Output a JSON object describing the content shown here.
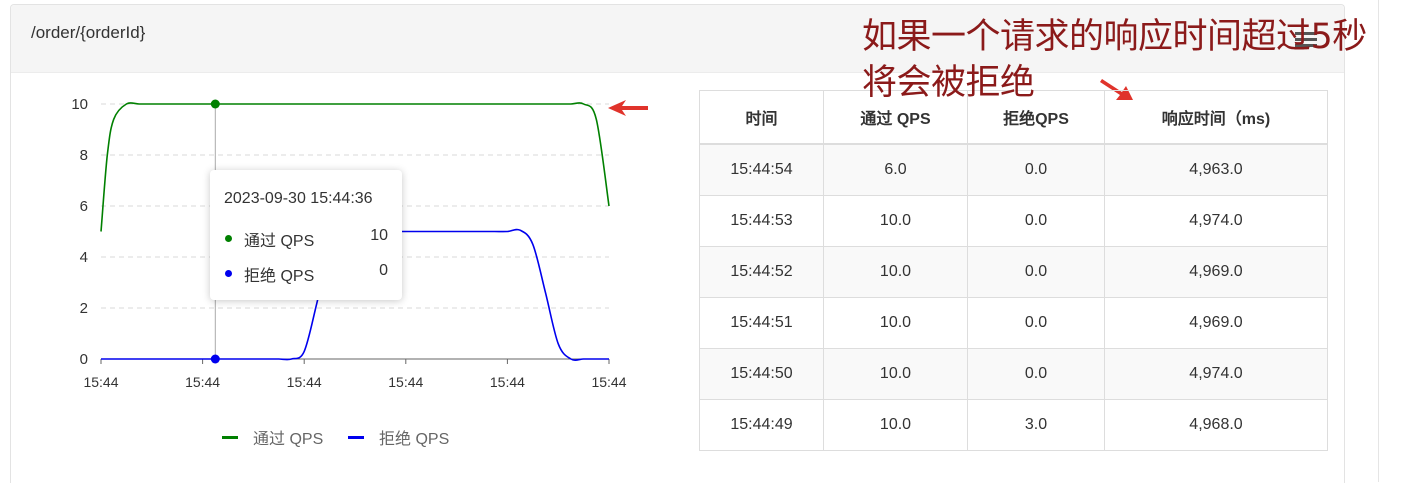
{
  "resource_title": "/order/{orderId}",
  "annotation": {
    "line1": "如果一个请求的响应时间超过5秒",
    "line2": "将会被拒绝"
  },
  "colors": {
    "pass": "#008000",
    "reject": "#0000ee",
    "annotation": "#8b1a1a",
    "arrow": "#e0332b"
  },
  "icons": [
    "red-arrow-icon",
    "red-arrow-icon",
    "settings-icon"
  ],
  "tooltip": {
    "time": "2023-09-30 15:44:36",
    "rows": [
      {
        "name": "通过 QPS",
        "value": "10"
      },
      {
        "name": "拒绝 QPS",
        "value": "0"
      }
    ]
  },
  "chart_data": {
    "type": "line",
    "x": [
      0,
      0.25,
      0.5,
      1,
      1.5,
      2,
      2.5,
      3,
      3.5,
      4,
      4.5,
      5,
      5.5,
      6,
      6.5,
      7,
      7.5,
      8,
      8.5,
      9,
      9.5,
      10,
      10.5,
      11,
      11.5,
      12,
      12.5,
      13,
      13.5,
      14,
      14.5,
      15,
      15.5,
      16,
      16.5,
      17,
      17.5,
      18,
      18.5,
      19,
      19.5,
      20
    ],
    "categories": [
      "15:44",
      "15:44",
      "15:44",
      "15:44",
      "15:44",
      "15:44"
    ],
    "ylim": [
      0,
      10
    ],
    "yticks": [
      "0",
      "2",
      "4",
      "6",
      "8",
      "10"
    ],
    "series": [
      {
        "name": "通过 QPS",
        "values": [
          5,
          8,
          9.4,
          10,
          10,
          10,
          10,
          10,
          10,
          10,
          10,
          10,
          10,
          10,
          10,
          10,
          10,
          10,
          10,
          10,
          10,
          10,
          10,
          10,
          10,
          10,
          10,
          10,
          10,
          10,
          10,
          10,
          10,
          10,
          10,
          10,
          10,
          10,
          10,
          10,
          9.4,
          6
        ]
      },
      {
        "name": "拒绝 QPS",
        "values": [
          0,
          0,
          0,
          0,
          0,
          0,
          0,
          0,
          0,
          0,
          0,
          0,
          0,
          0,
          0,
          0,
          0,
          0.3,
          2.2,
          4.3,
          5,
          5,
          5,
          5,
          5,
          5,
          5,
          5,
          5,
          5,
          5,
          5,
          5,
          5,
          5.05,
          4.5,
          2.6,
          0.6,
          0,
          0,
          0,
          0
        ]
      }
    ],
    "legend": "bottom",
    "grid": true
  },
  "table": {
    "headers": [
      "时间",
      "通过 QPS",
      "拒绝QPS",
      "响应时间（ms)"
    ],
    "rows": [
      [
        "15:44:54",
        "6.0",
        "0.0",
        "4,963.0"
      ],
      [
        "15:44:53",
        "10.0",
        "0.0",
        "4,974.0"
      ],
      [
        "15:44:52",
        "10.0",
        "0.0",
        "4,969.0"
      ],
      [
        "15:44:51",
        "10.0",
        "0.0",
        "4,969.0"
      ],
      [
        "15:44:50",
        "10.0",
        "0.0",
        "4,974.0"
      ],
      [
        "15:44:49",
        "10.0",
        "3.0",
        "4,968.0"
      ]
    ]
  }
}
